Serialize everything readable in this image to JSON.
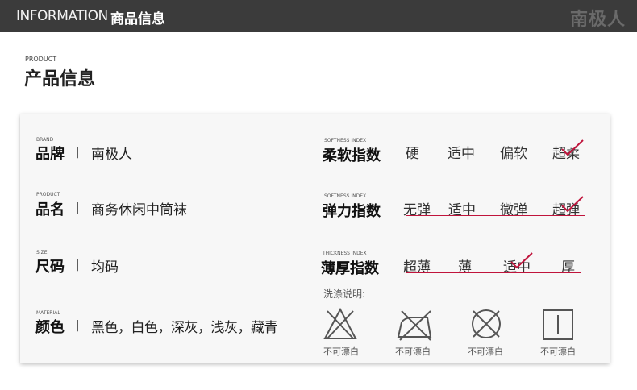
{
  "header": {
    "title_en": "INFORMATION",
    "title_cn": "商品信息",
    "brand": "南极人"
  },
  "section": {
    "label_en": "PRODUCT",
    "label_cn": "产品信息"
  },
  "info": [
    {
      "label_en": "BRAND",
      "label_cn": "品牌",
      "separator": "|",
      "value": "南极人"
    },
    {
      "label_en": "PRODUCT",
      "label_cn": "品名",
      "separator": "|",
      "value": "商务休闲中筒袜"
    },
    {
      "label_en": "SIZE",
      "label_cn": "尺码",
      "separator": "|",
      "value": "均码"
    },
    {
      "label_en": "MATERIAL",
      "label_cn": "颜色",
      "separator": "|",
      "value": "黑色，白色，深灰，浅灰，藏青"
    }
  ],
  "indices": [
    {
      "label_en": "SOFTNESS INDEX",
      "label_cn": "柔软指数",
      "options": [
        "硬",
        "适中",
        "偏软",
        "超柔"
      ],
      "selected": "超柔"
    },
    {
      "label_en": "SOFTNESS INDEX",
      "label_cn": "弹力指数",
      "options": [
        "无弹",
        "适中",
        "微弹",
        "超弹"
      ],
      "selected": "超弹"
    },
    {
      "label_en": "THICKNESS INDEX",
      "label_cn": "薄厚指数",
      "options": [
        "超薄",
        "薄",
        "适中",
        "厚"
      ],
      "selected": "适中"
    }
  ],
  "washing": {
    "title": "洗涤说明:",
    "items": [
      {
        "icon": "no-bleach-triangle-icon",
        "label": "不可漂白"
      },
      {
        "icon": "no-iron-icon",
        "label": "不可漂白"
      },
      {
        "icon": "no-tumble-dry-icon",
        "label": "不可漂白"
      },
      {
        "icon": "line-dry-icon",
        "label": "不可漂白"
      }
    ]
  },
  "colors": {
    "accent": "#c0143c",
    "topbar": "#3b3b3b",
    "card": "#f7f7f7"
  }
}
